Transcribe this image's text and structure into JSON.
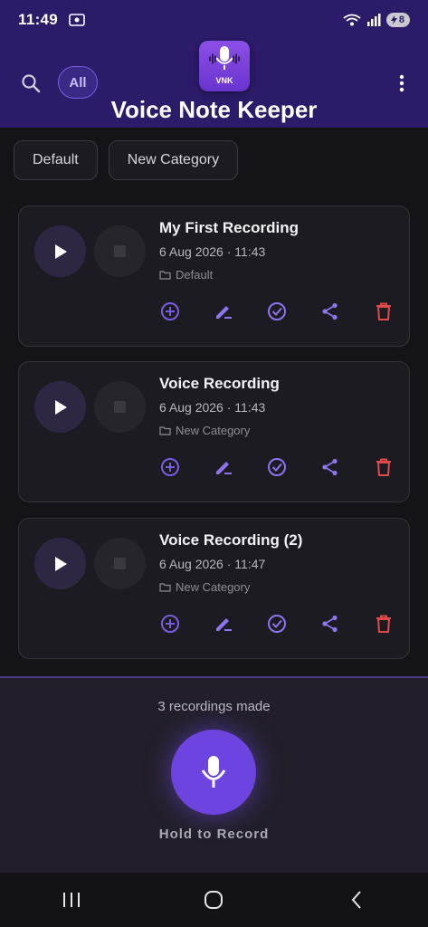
{
  "status": {
    "time": "11:49",
    "battery": "8"
  },
  "header": {
    "app_title": "Voice Note Keeper",
    "logo_text": "VNK",
    "filter_all": "All"
  },
  "categories": [
    "Default",
    "New Category"
  ],
  "recordings": [
    {
      "title": "My First Recording",
      "date": "6 Aug 2026 · 11:43",
      "category": "Default"
    },
    {
      "title": "Voice Recording",
      "date": "6 Aug 2026 · 11:43",
      "category": "New Category"
    },
    {
      "title": "Voice Recording (2)",
      "date": "6 Aug 2026 · 11:47",
      "category": "New Category"
    }
  ],
  "bottom": {
    "count_text": "3 recordings made",
    "hold_label": "Hold to Record"
  },
  "colors": {
    "accent": "#7a5ce0",
    "header_bg": "#2b1b68",
    "delete": "#e0484a"
  },
  "icons": [
    "search-icon",
    "more-vert-icon",
    "play-icon",
    "stop-icon",
    "folder-icon",
    "add-circle-icon",
    "edit-icon",
    "check-circle-icon",
    "share-icon",
    "delete-icon",
    "mic-icon"
  ]
}
